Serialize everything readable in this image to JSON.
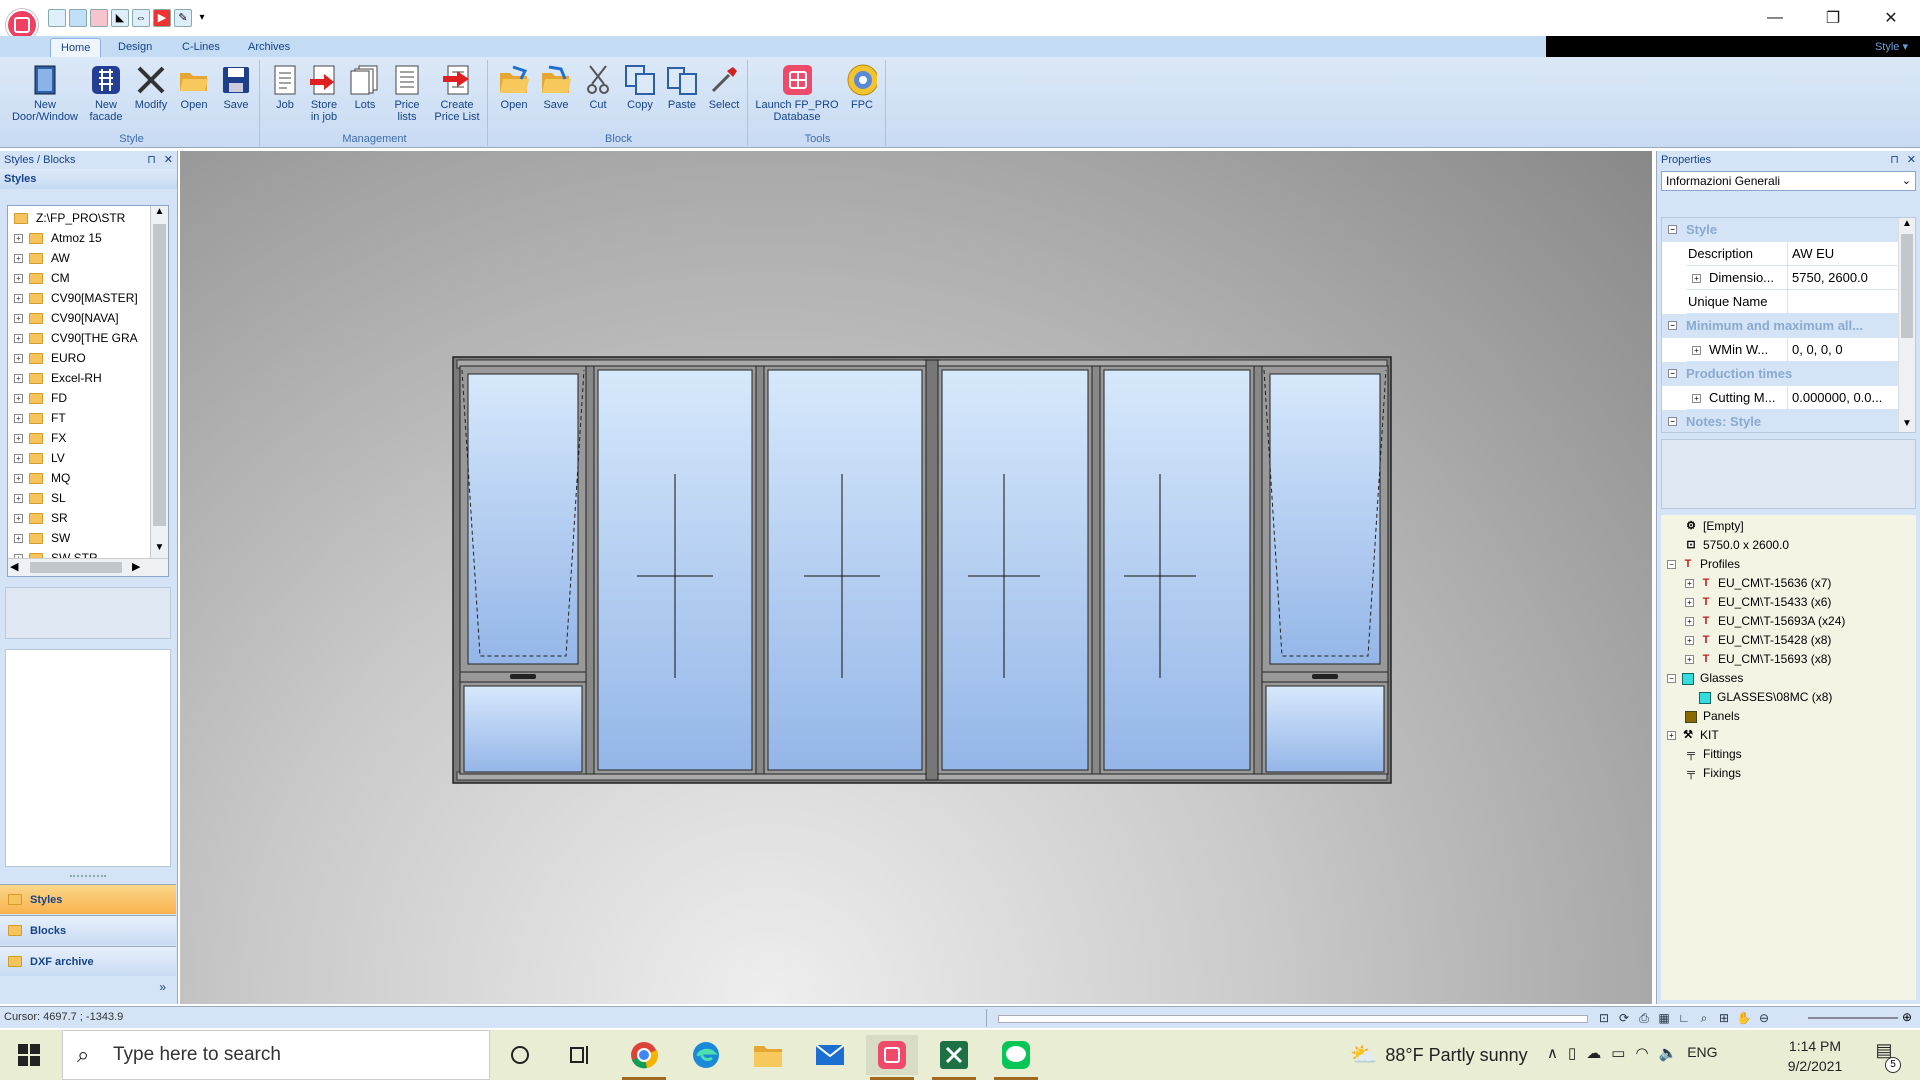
{
  "titlebar": {
    "qat_icons": [
      "new-icon",
      "view-icon",
      "style-icon",
      "arrow-icon",
      "resize-icon",
      "export-icon",
      "pick-icon"
    ],
    "qat_more": "▾"
  },
  "ribbon": {
    "tabs": [
      {
        "label": "Home",
        "active": true
      },
      {
        "label": "Design",
        "active": false
      },
      {
        "label": "C-Lines",
        "active": false
      },
      {
        "label": "Archives",
        "active": false
      }
    ],
    "style_menu": "Style ▾",
    "groups": [
      {
        "label": "Style",
        "buttons": [
          {
            "label_1": "New",
            "label_2": "Door/Window",
            "icon": "new-door-window-icon"
          },
          {
            "label_1": "New",
            "label_2": "facade",
            "icon": "new-facade-icon"
          },
          {
            "label_1": "Modify",
            "label_2": "",
            "icon": "modify-icon"
          },
          {
            "label_1": "Open",
            "label_2": "",
            "icon": "open-folder-icon"
          },
          {
            "label_1": "Save",
            "label_2": "",
            "icon": "save-icon"
          }
        ]
      },
      {
        "label": "Management",
        "buttons": [
          {
            "label_1": "Job",
            "label_2": "",
            "icon": "job-icon"
          },
          {
            "label_1": "Store",
            "label_2": "in job",
            "icon": "store-in-job-icon"
          },
          {
            "label_1": "Lots",
            "label_2": "",
            "icon": "lots-icon"
          },
          {
            "label_1": "Price",
            "label_2": "lists",
            "icon": "price-lists-icon"
          },
          {
            "label_1": "Create",
            "label_2": "Price List",
            "icon": "create-price-list-icon"
          }
        ]
      },
      {
        "label": "Block",
        "buttons": [
          {
            "label_1": "Open",
            "label_2": "",
            "icon": "block-open-icon"
          },
          {
            "label_1": "Save",
            "label_2": "",
            "icon": "block-save-icon"
          },
          {
            "label_1": "Cut",
            "label_2": "",
            "icon": "cut-icon"
          },
          {
            "label_1": "Copy",
            "label_2": "",
            "icon": "copy-icon"
          },
          {
            "label_1": "Paste",
            "label_2": "",
            "icon": "paste-icon"
          },
          {
            "label_1": "Select",
            "label_2": "",
            "icon": "select-icon"
          }
        ]
      },
      {
        "label": "Tools",
        "buttons": [
          {
            "label_1": "Launch FP_PRO",
            "label_2": "Database",
            "icon": "launch-database-icon"
          },
          {
            "label_1": "FPC",
            "label_2": "",
            "icon": "fpc-icon"
          }
        ]
      }
    ]
  },
  "left_panel": {
    "title": "Styles / Blocks",
    "section": "Styles",
    "tree_root": "Z:\\FP_PRO\\STR",
    "tree_items": [
      "Atmoz 15",
      "AW",
      "CM",
      "CV90[MASTER]",
      "CV90[NAVA]",
      "CV90[THE GRA",
      "EURO",
      "Excel-RH",
      "FD",
      "FT",
      "FX",
      "LV",
      "MQ",
      "SL",
      "SR",
      "SW",
      "SW STR"
    ],
    "nav": {
      "styles": "Styles",
      "blocks": "Blocks",
      "dxf": "DXF archive",
      "more": "»"
    }
  },
  "right_panel": {
    "title": "Properties",
    "selector": "Informazioni Generali",
    "categories": {
      "style": "Style",
      "minmax": "Minimum and maximum all...",
      "production": "Production times",
      "notes": "Notes: Style"
    },
    "rows": {
      "description": {
        "name": "Description",
        "value": "AW EU"
      },
      "dimension": {
        "name": "Dimensio...",
        "value": "5750, 2600.0"
      },
      "unique_name": {
        "name": "Unique Name",
        "value": ""
      },
      "wmin": {
        "name": "WMin W...",
        "value": "0, 0, 0, 0"
      },
      "cutting": {
        "name": "Cutting M...",
        "value": "0.000000, 0.0..."
      }
    },
    "components": {
      "empty": "[Empty]",
      "size": "5750.0 x 2600.0",
      "profiles": "Profiles",
      "profile_items": [
        "EU_CM\\T-15636 (x7)",
        "EU_CM\\T-15433 (x6)",
        "EU_CM\\T-15693A (x24)",
        "EU_CM\\T-15428 (x8)",
        "EU_CM\\T-15693 (x8)"
      ],
      "glasses": "Glasses",
      "glass_item": "GLASSES\\08MC (x8)",
      "panels": "Panels",
      "kit": "KIT",
      "fittings": "Fittings",
      "fixings": "Fixings"
    }
  },
  "statusbar": {
    "cursor": "Cursor:   4697.7 ; -1343.9"
  },
  "taskbar": {
    "search_placeholder": "Type here to search",
    "weather": "88°F  Partly sunny",
    "language": "ENG",
    "time": "1:14 PM",
    "date": "9/2/2021",
    "notifications": "5"
  },
  "colors": {
    "ribbon_bg": "#c8dbf3",
    "accent": "#15428b",
    "nav_active": "#f9b24c",
    "glass_top": "#d6e8fb",
    "glass_bottom": "#94b6e8"
  }
}
